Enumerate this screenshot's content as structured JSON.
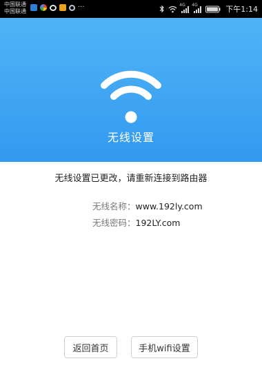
{
  "status_bar": {
    "carrier_1": "中国联通",
    "carrier_2": "中国联通",
    "more": "···",
    "network_1": "4G",
    "network_2": "4G",
    "time": "下午1:14",
    "icons": [
      "bluetooth-icon",
      "wifi-icon",
      "signal-icon",
      "signal-icon",
      "battery-icon"
    ]
  },
  "header": {
    "title": "无线设置",
    "icon": "wifi-icon"
  },
  "main": {
    "message": "无线设置已更改，请重新连接到路由器",
    "wifi_name_label": "无线名称：",
    "wifi_name_value": "www.192ly.com",
    "wifi_password_label": "无线密码：",
    "wifi_password_value": "192LY.com"
  },
  "buttons": {
    "back_home": "返回首页",
    "phone_wifi_settings": "手机wifi设置"
  },
  "colors": {
    "header_top": "#4fb5f6",
    "header_bottom": "#3399f0",
    "status_bar": "#000000"
  }
}
